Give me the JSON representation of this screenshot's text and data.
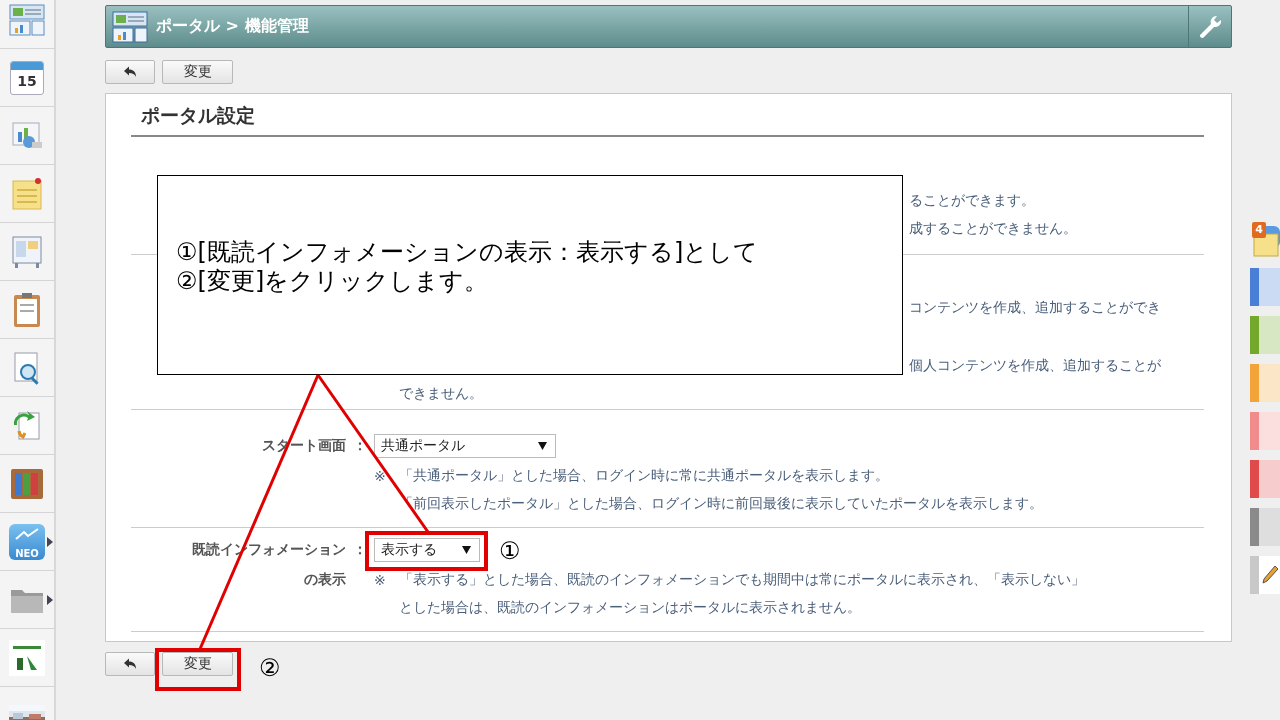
{
  "sidebar": {
    "items": [
      {
        "kind": "portal",
        "has_menu": false
      },
      {
        "kind": "calendar",
        "label": "15",
        "has_menu": false
      },
      {
        "kind": "chart",
        "has_menu": false
      },
      {
        "kind": "memo",
        "has_menu": false
      },
      {
        "kind": "board",
        "has_menu": false
      },
      {
        "kind": "clipboard",
        "has_menu": false
      },
      {
        "kind": "search",
        "has_menu": false
      },
      {
        "kind": "sync",
        "has_menu": false
      },
      {
        "kind": "binders",
        "has_menu": false
      },
      {
        "kind": "neo",
        "label": "NEO",
        "has_menu": true
      },
      {
        "kind": "folder",
        "has_menu": true
      },
      {
        "kind": "shop",
        "has_menu": false
      },
      {
        "kind": "picture",
        "has_menu": false
      }
    ]
  },
  "header": {
    "breadcrumb": "ポータル > 機能管理"
  },
  "toolbar": {
    "buttons": [
      {
        "kind": "back"
      },
      {
        "kind": "text",
        "label": "変更"
      }
    ]
  },
  "panel": {
    "title": "ポータル設定",
    "rows": [
      {
        "kind": "covered",
        "lines": [
          {
            "kind": "tail",
            "text": "ることができます。"
          },
          {
            "kind": "tail",
            "text": "成することができません。"
          }
        ]
      },
      {
        "kind": "covered",
        "lines": [
          {
            "kind": "tail",
            "text": "コンテンツを作成、追加することができ"
          },
          {
            "kind": "tail",
            "text": "個人コンテンツを作成、追加することが"
          },
          {
            "kind": "line",
            "text": "できません。"
          }
        ]
      },
      {
        "kind": "setting",
        "label": [
          "スタート画面"
        ],
        "colon": "：",
        "value": "共通ポータル",
        "note_mark": "※",
        "notes": [
          "「共通ポータル」とした場合、ログイン時に常に共通ポータルを表示します。",
          "「前回表示したポータル」とした場合、ログイン時に前回最後に表示していたポータルを表示します。"
        ]
      },
      {
        "kind": "setting",
        "label": [
          "既読インフォメーション",
          "の表示"
        ],
        "colon": "：",
        "value": "表示する",
        "note_mark": "※",
        "notes": [
          "「表示する」とした場合、既読のインフォメーションでも期間中は常にポータルに表示され、「表示しない」",
          "とした場合は、既読のインフォメーションはポータルに表示されません。"
        ]
      }
    ]
  },
  "bottom_toolbar": {
    "buttons": [
      {
        "kind": "back"
      },
      {
        "kind": "text",
        "label": "変更"
      }
    ]
  },
  "callout": {
    "lines": [
      "①[既読インフォメーションの表示：表示する]として",
      "②[変更]をクリックします。"
    ]
  },
  "markers": [
    "①",
    "②"
  ],
  "right_dock": {
    "items": [
      {
        "kind": "memo",
        "badge": "4"
      },
      {
        "kind": "tab",
        "color": "#4a7fd8"
      },
      {
        "kind": "tab",
        "color": "#74a82a"
      },
      {
        "kind": "tab",
        "color": "#f2a43a"
      },
      {
        "kind": "tab",
        "color": "#f08c8c"
      },
      {
        "kind": "tab",
        "color": "#e04a4a"
      },
      {
        "kind": "tab",
        "color": "#8a8a8a"
      },
      {
        "kind": "pencil"
      }
    ]
  }
}
